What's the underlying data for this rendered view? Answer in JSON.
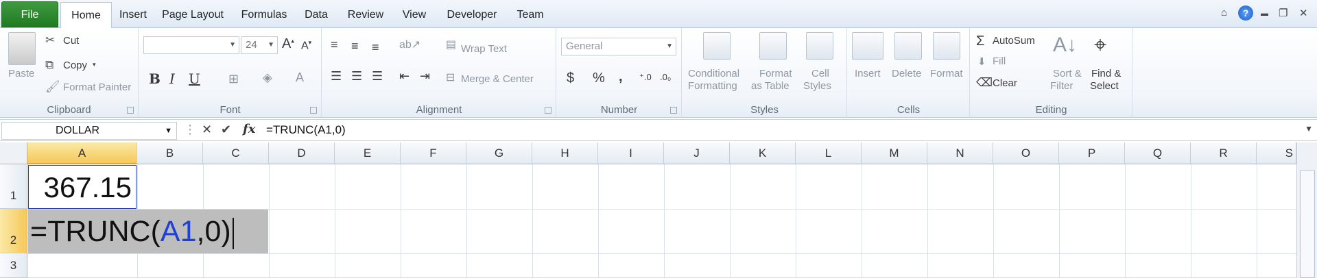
{
  "tabs": [
    "File",
    "Home",
    "Insert",
    "Page Layout",
    "Formulas",
    "Data",
    "Review",
    "View",
    "Developer",
    "Team"
  ],
  "window_controls": {
    "help": "?",
    "minimize": "▬",
    "restore": "❐",
    "close": "✕",
    "ribbon_toggle": "⌂"
  },
  "clipboard": {
    "paste": "Paste",
    "cut": "Cut",
    "copy": "Copy",
    "format_painter": "Format Painter",
    "label": "Clipboard"
  },
  "font": {
    "name": "",
    "size": "24",
    "label": "Font",
    "bold": "B",
    "italic": "I",
    "underline": "U"
  },
  "alignment": {
    "wrap_text": "Wrap Text",
    "merge_center": "Merge & Center",
    "label": "Alignment"
  },
  "number": {
    "format": "General",
    "currency": "$",
    "percent": "%",
    "comma": ",",
    "label": "Number"
  },
  "styles": {
    "conditional": "Conditional",
    "conditional2": "Formatting",
    "format_table": "Format",
    "format_table2": "as Table",
    "cell_styles": "Cell",
    "cell_styles2": "Styles",
    "label": "Styles"
  },
  "cells": {
    "insert": "Insert",
    "delete": "Delete",
    "format": "Format",
    "label": "Cells"
  },
  "editing": {
    "autosum": "AutoSum",
    "fill": "Fill",
    "clear": "Clear",
    "sort": "Sort &",
    "sort2": "Filter",
    "find": "Find &",
    "find2": "Select",
    "label": "Editing"
  },
  "formula_bar": {
    "name_box": "DOLLAR",
    "formula": "=TRUNC(A1,0)"
  },
  "columns": [
    "A",
    "B",
    "C",
    "D",
    "E",
    "F",
    "G",
    "H",
    "I",
    "J",
    "K",
    "L",
    "M",
    "N",
    "O",
    "P",
    "Q",
    "R",
    "S"
  ],
  "rows": [
    "1",
    "2",
    "3"
  ],
  "cells_data": {
    "A1": "367.15",
    "edit_prefix": "=TRUNC(",
    "edit_ref": "A1",
    "edit_suffix": ",0)"
  }
}
